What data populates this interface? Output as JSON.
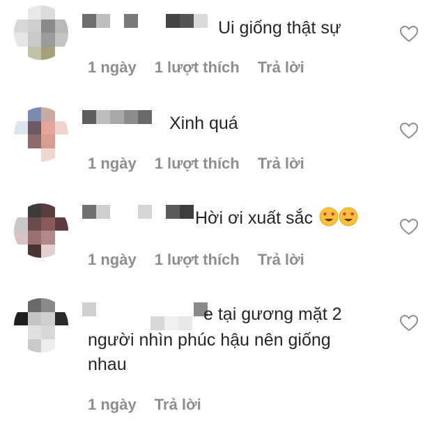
{
  "comments": [
    {
      "text": "Ui giống thật sự",
      "time": "1 ngày",
      "likes": "1 lượt thích",
      "reply": "Trả lời"
    },
    {
      "text": "Xinh quá",
      "time": "1 ngày",
      "likes": "1 lượt thích",
      "reply": "Trả lời"
    },
    {
      "text": "Hời ơi xuất sắc",
      "emoji": "heart-eyes-emoji",
      "time": "1 ngày",
      "likes": "1 lượt thích",
      "reply": "Trả lời"
    },
    {
      "text_line1": "e tại gương mặt 2",
      "text_line2": "người nhìn phúc hậu nên giống",
      "text_line3": "nhau",
      "time": "1 ngày",
      "reply": "Trả lời"
    }
  ],
  "icons": {
    "like": "heart-outline-icon"
  },
  "colors": {
    "text": "#262626",
    "meta": "#8e8e8e",
    "heart_stroke": "#8e8e8e"
  }
}
